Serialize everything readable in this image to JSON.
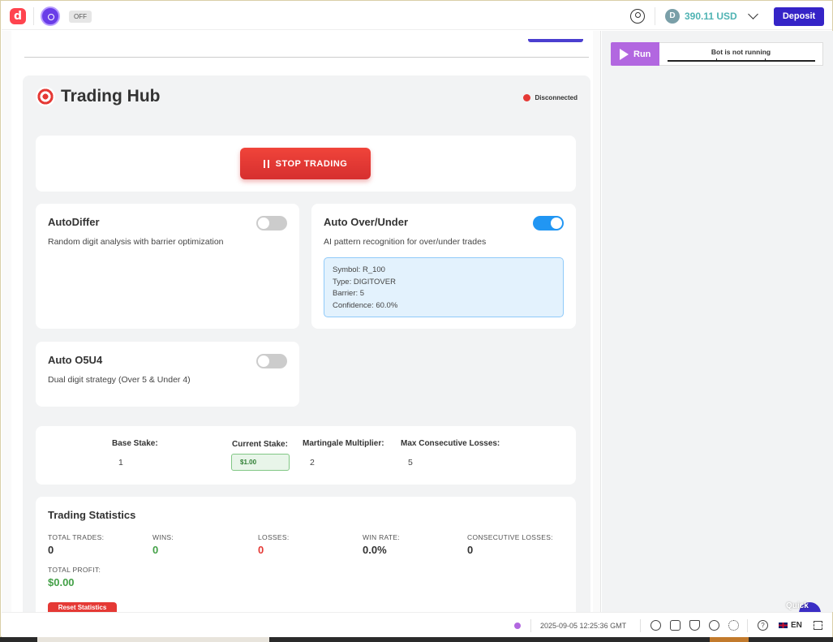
{
  "header": {
    "logo_letter": "d",
    "app_icon": "app-icon",
    "off_badge": "OFF",
    "user_icon": "user-icon",
    "coin_icon": "coin-icon",
    "balance": "390.11 USD",
    "deposit_label": "Deposit"
  },
  "trading_hub": {
    "title": "Trading Hub",
    "title_icon": "target-icon",
    "connection_status": "Disconnected",
    "stop_label": "STOP TRADING",
    "strategies": [
      {
        "title": "AutoDiffer",
        "description": "Random digit analysis with barrier optimization",
        "enabled": false
      },
      {
        "title": "Auto Over/Under",
        "description": "AI pattern recognition for over/under trades",
        "enabled": true,
        "info": {
          "symbol": "Symbol: R_100",
          "type": "Type: DIGITOVER",
          "barrier": "Barrier: 5",
          "confidence": "Confidence: 60.0%"
        }
      },
      {
        "title": "Auto O5U4",
        "description": "Dual digit strategy (Over 5 & Under 4)",
        "enabled": false
      }
    ],
    "settings": {
      "base_stake_label": "Base Stake:",
      "base_stake_value": "1",
      "current_stake_label": "Current Stake:",
      "current_stake_value": "$1.00",
      "martingale_label": "Martingale Multiplier:",
      "martingale_value": "2",
      "max_losses_label": "Max Consecutive Losses:",
      "max_losses_value": "5"
    },
    "statistics": {
      "title": "Trading Statistics",
      "total_trades_label": "TOTAL TRADES:",
      "total_trades": "0",
      "wins_label": "WINS:",
      "wins": "0",
      "losses_label": "LOSSES:",
      "losses": "0",
      "win_rate_label": "WIN RATE:",
      "win_rate": "0.0%",
      "consecutive_losses_label": "CONSECUTIVE LOSSES:",
      "consecutive_losses": "0",
      "total_profit_label": "TOTAL PROFIT:",
      "total_profit": "$0.00",
      "reset_label": "Reset Statistics"
    }
  },
  "bot_panel": {
    "run_label": "Run",
    "status": "Bot is not running",
    "quick_strategy": "Quick Strategy"
  },
  "footer": {
    "timestamp": "2025-09-05 12:25:36 GMT",
    "language": "EN"
  },
  "colors": {
    "brand_red": "#ff444f",
    "deposit_blue": "#3524c7",
    "stop_red": "#e53935",
    "toggle_on": "#2196f3",
    "run_purple": "#b267e0",
    "balance_teal": "#4fb3b3"
  }
}
